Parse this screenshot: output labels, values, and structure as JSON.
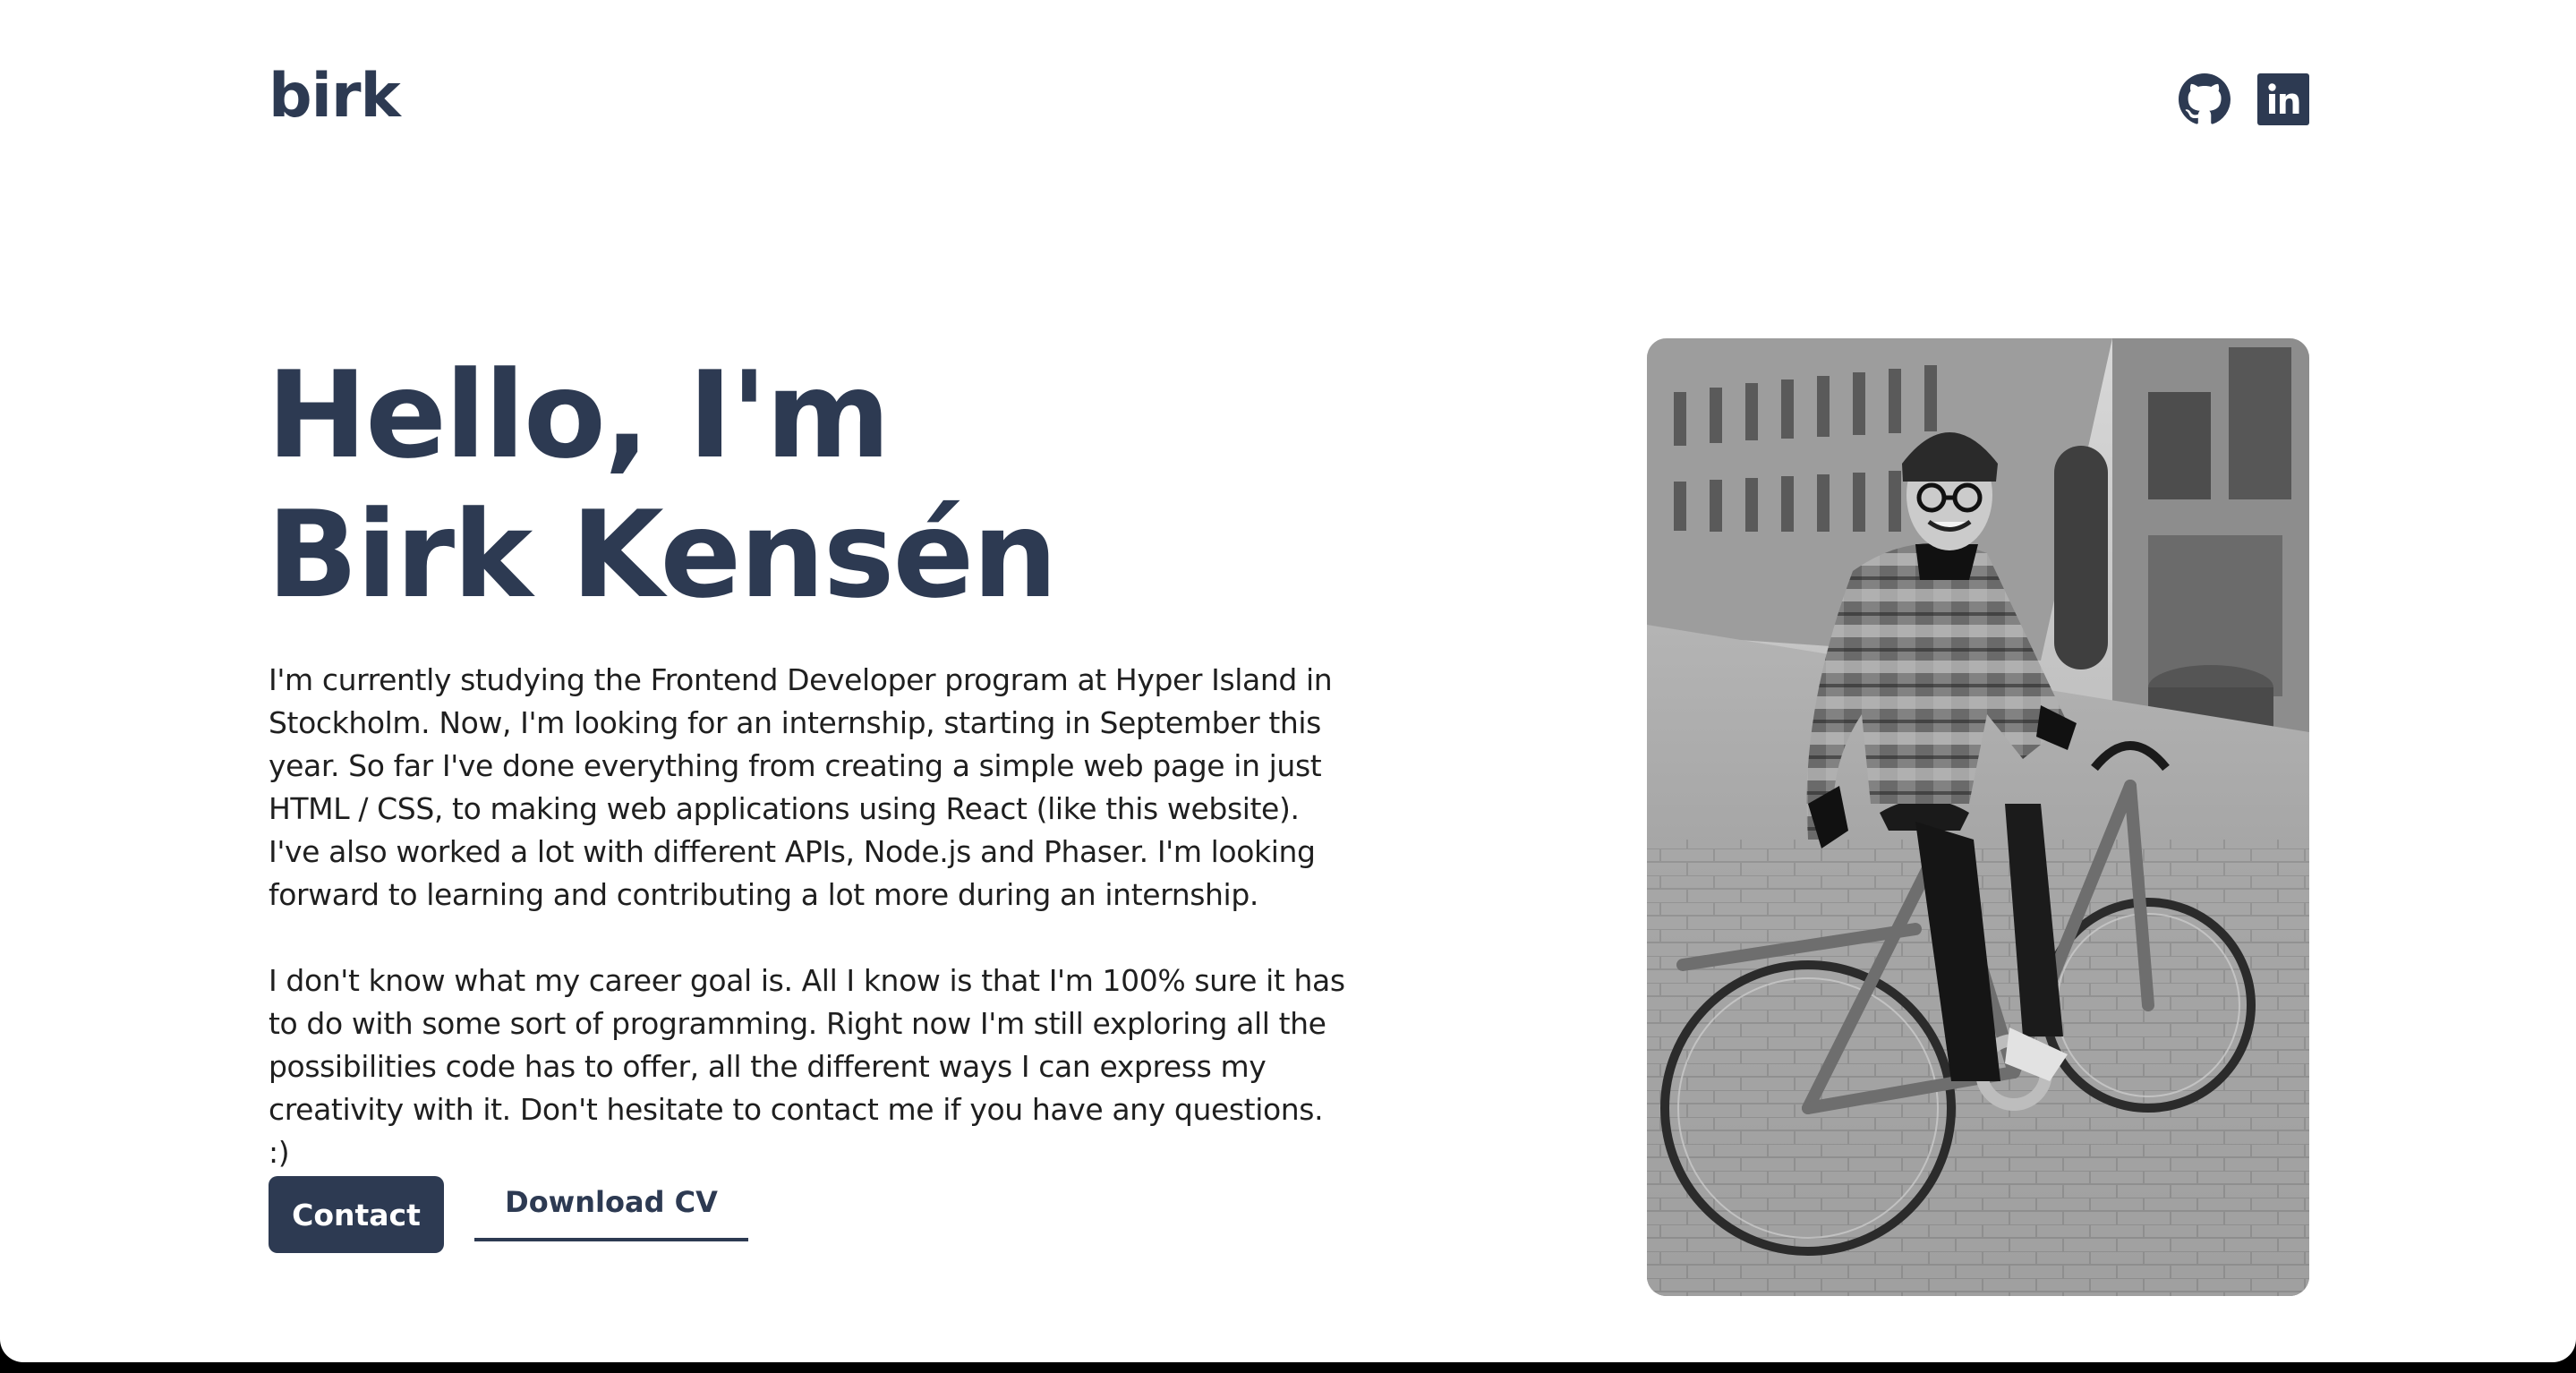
{
  "header": {
    "logo": "birk",
    "social": [
      {
        "icon": "github-icon"
      },
      {
        "icon": "linkedin-icon"
      }
    ]
  },
  "hero": {
    "headline_line1": "Hello, I'm",
    "headline_line2": "Birk Kensén",
    "paragraph1": "I'm currently studying the Frontend Developer program at Hyper Island in Stockholm. Now, I'm looking for an internship, starting in September this year. So far I've done everything from creating a simple web page in just HTML / CSS, to making web applications using React (like this website). I've also worked a lot with different APIs, Node.js and Phaser. I'm looking forward to learning and contributing a lot more during an internship.",
    "paragraph2": "I don't know what my career goal is. All I know is that I'm 100% sure it has to do with some sort of programming. Right now I'm still exploring all the possibilities code has to offer, all the different ways I can express my creativity with it. Don't hesitate to contact me if you have any questions. :)",
    "contact_label": "Contact",
    "cv_label": "Download CV"
  },
  "colors": {
    "primary": "#2d3a52",
    "background": "#ffffff",
    "text": "#1f1f1f"
  }
}
